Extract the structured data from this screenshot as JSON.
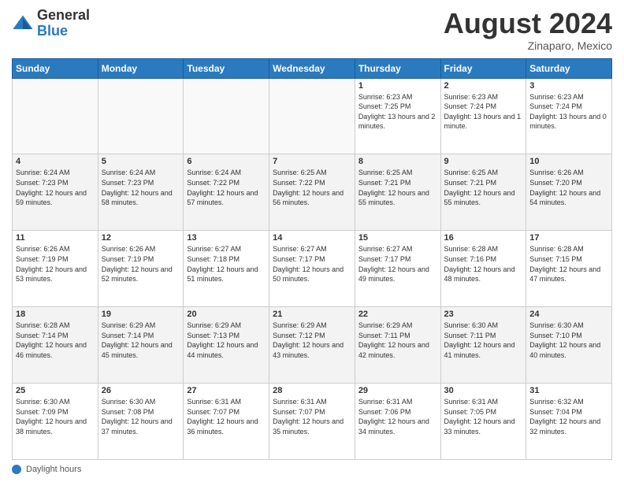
{
  "header": {
    "logo_general": "General",
    "logo_blue": "Blue",
    "month_title": "August 2024",
    "location": "Zinaparo, Mexico"
  },
  "days_of_week": [
    "Sunday",
    "Monday",
    "Tuesday",
    "Wednesday",
    "Thursday",
    "Friday",
    "Saturday"
  ],
  "weeks": [
    [
      {
        "day": "",
        "empty": true
      },
      {
        "day": "",
        "empty": true
      },
      {
        "day": "",
        "empty": true
      },
      {
        "day": "",
        "empty": true
      },
      {
        "day": "1",
        "sunrise": "6:23 AM",
        "sunset": "7:25 PM",
        "daylight": "13 hours and 2 minutes."
      },
      {
        "day": "2",
        "sunrise": "6:23 AM",
        "sunset": "7:24 PM",
        "daylight": "13 hours and 1 minute."
      },
      {
        "day": "3",
        "sunrise": "6:23 AM",
        "sunset": "7:24 PM",
        "daylight": "13 hours and 0 minutes."
      }
    ],
    [
      {
        "day": "4",
        "sunrise": "6:24 AM",
        "sunset": "7:23 PM",
        "daylight": "12 hours and 59 minutes."
      },
      {
        "day": "5",
        "sunrise": "6:24 AM",
        "sunset": "7:23 PM",
        "daylight": "12 hours and 58 minutes."
      },
      {
        "day": "6",
        "sunrise": "6:24 AM",
        "sunset": "7:22 PM",
        "daylight": "12 hours and 57 minutes."
      },
      {
        "day": "7",
        "sunrise": "6:25 AM",
        "sunset": "7:22 PM",
        "daylight": "12 hours and 56 minutes."
      },
      {
        "day": "8",
        "sunrise": "6:25 AM",
        "sunset": "7:21 PM",
        "daylight": "12 hours and 55 minutes."
      },
      {
        "day": "9",
        "sunrise": "6:25 AM",
        "sunset": "7:21 PM",
        "daylight": "12 hours and 55 minutes."
      },
      {
        "day": "10",
        "sunrise": "6:26 AM",
        "sunset": "7:20 PM",
        "daylight": "12 hours and 54 minutes."
      }
    ],
    [
      {
        "day": "11",
        "sunrise": "6:26 AM",
        "sunset": "7:19 PM",
        "daylight": "12 hours and 53 minutes."
      },
      {
        "day": "12",
        "sunrise": "6:26 AM",
        "sunset": "7:19 PM",
        "daylight": "12 hours and 52 minutes."
      },
      {
        "day": "13",
        "sunrise": "6:27 AM",
        "sunset": "7:18 PM",
        "daylight": "12 hours and 51 minutes."
      },
      {
        "day": "14",
        "sunrise": "6:27 AM",
        "sunset": "7:17 PM",
        "daylight": "12 hours and 50 minutes."
      },
      {
        "day": "15",
        "sunrise": "6:27 AM",
        "sunset": "7:17 PM",
        "daylight": "12 hours and 49 minutes."
      },
      {
        "day": "16",
        "sunrise": "6:28 AM",
        "sunset": "7:16 PM",
        "daylight": "12 hours and 48 minutes."
      },
      {
        "day": "17",
        "sunrise": "6:28 AM",
        "sunset": "7:15 PM",
        "daylight": "12 hours and 47 minutes."
      }
    ],
    [
      {
        "day": "18",
        "sunrise": "6:28 AM",
        "sunset": "7:14 PM",
        "daylight": "12 hours and 46 minutes."
      },
      {
        "day": "19",
        "sunrise": "6:29 AM",
        "sunset": "7:14 PM",
        "daylight": "12 hours and 45 minutes."
      },
      {
        "day": "20",
        "sunrise": "6:29 AM",
        "sunset": "7:13 PM",
        "daylight": "12 hours and 44 minutes."
      },
      {
        "day": "21",
        "sunrise": "6:29 AM",
        "sunset": "7:12 PM",
        "daylight": "12 hours and 43 minutes."
      },
      {
        "day": "22",
        "sunrise": "6:29 AM",
        "sunset": "7:11 PM",
        "daylight": "12 hours and 42 minutes."
      },
      {
        "day": "23",
        "sunrise": "6:30 AM",
        "sunset": "7:11 PM",
        "daylight": "12 hours and 41 minutes."
      },
      {
        "day": "24",
        "sunrise": "6:30 AM",
        "sunset": "7:10 PM",
        "daylight": "12 hours and 40 minutes."
      }
    ],
    [
      {
        "day": "25",
        "sunrise": "6:30 AM",
        "sunset": "7:09 PM",
        "daylight": "12 hours and 38 minutes."
      },
      {
        "day": "26",
        "sunrise": "6:30 AM",
        "sunset": "7:08 PM",
        "daylight": "12 hours and 37 minutes."
      },
      {
        "day": "27",
        "sunrise": "6:31 AM",
        "sunset": "7:07 PM",
        "daylight": "12 hours and 36 minutes."
      },
      {
        "day": "28",
        "sunrise": "6:31 AM",
        "sunset": "7:07 PM",
        "daylight": "12 hours and 35 minutes."
      },
      {
        "day": "29",
        "sunrise": "6:31 AM",
        "sunset": "7:06 PM",
        "daylight": "12 hours and 34 minutes."
      },
      {
        "day": "30",
        "sunrise": "6:31 AM",
        "sunset": "7:05 PM",
        "daylight": "12 hours and 33 minutes."
      },
      {
        "day": "31",
        "sunrise": "6:32 AM",
        "sunset": "7:04 PM",
        "daylight": "12 hours and 32 minutes."
      }
    ]
  ],
  "footer": {
    "daylight_label": "Daylight hours"
  }
}
